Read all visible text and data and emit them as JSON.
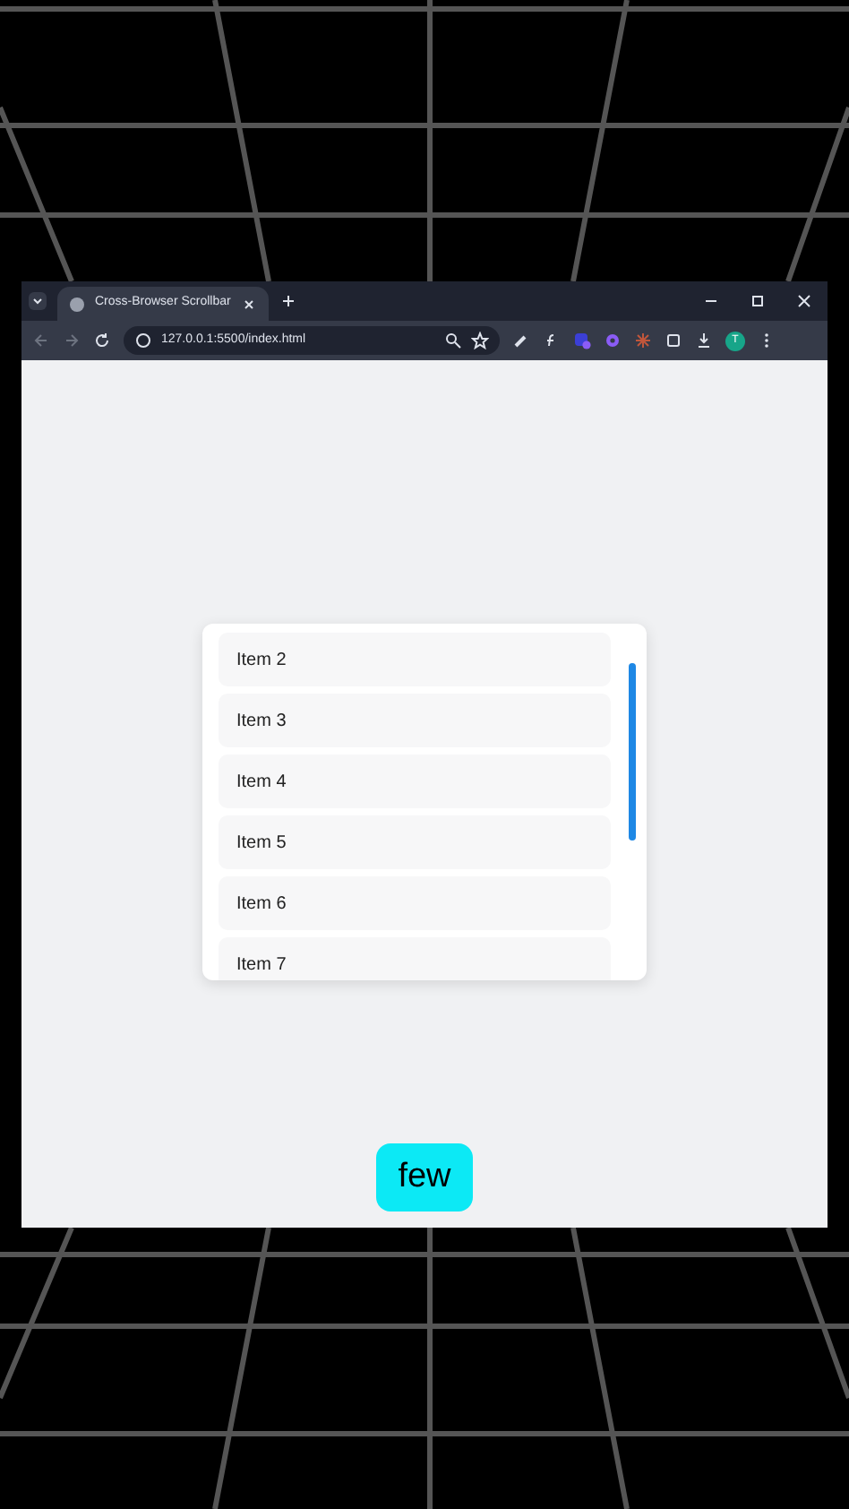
{
  "browser": {
    "tab": {
      "title": "Cross-Browser Scrollbar",
      "selected": true
    },
    "address": "127.0.0.1:5500/index.html",
    "profile_initial": "T"
  },
  "list": {
    "items": [
      {
        "label": "Item 2"
      },
      {
        "label": "Item 3"
      },
      {
        "label": "Item 4"
      },
      {
        "label": "Item 5"
      },
      {
        "label": "Item 6"
      },
      {
        "label": "Item 7"
      }
    ]
  },
  "caption": "few"
}
